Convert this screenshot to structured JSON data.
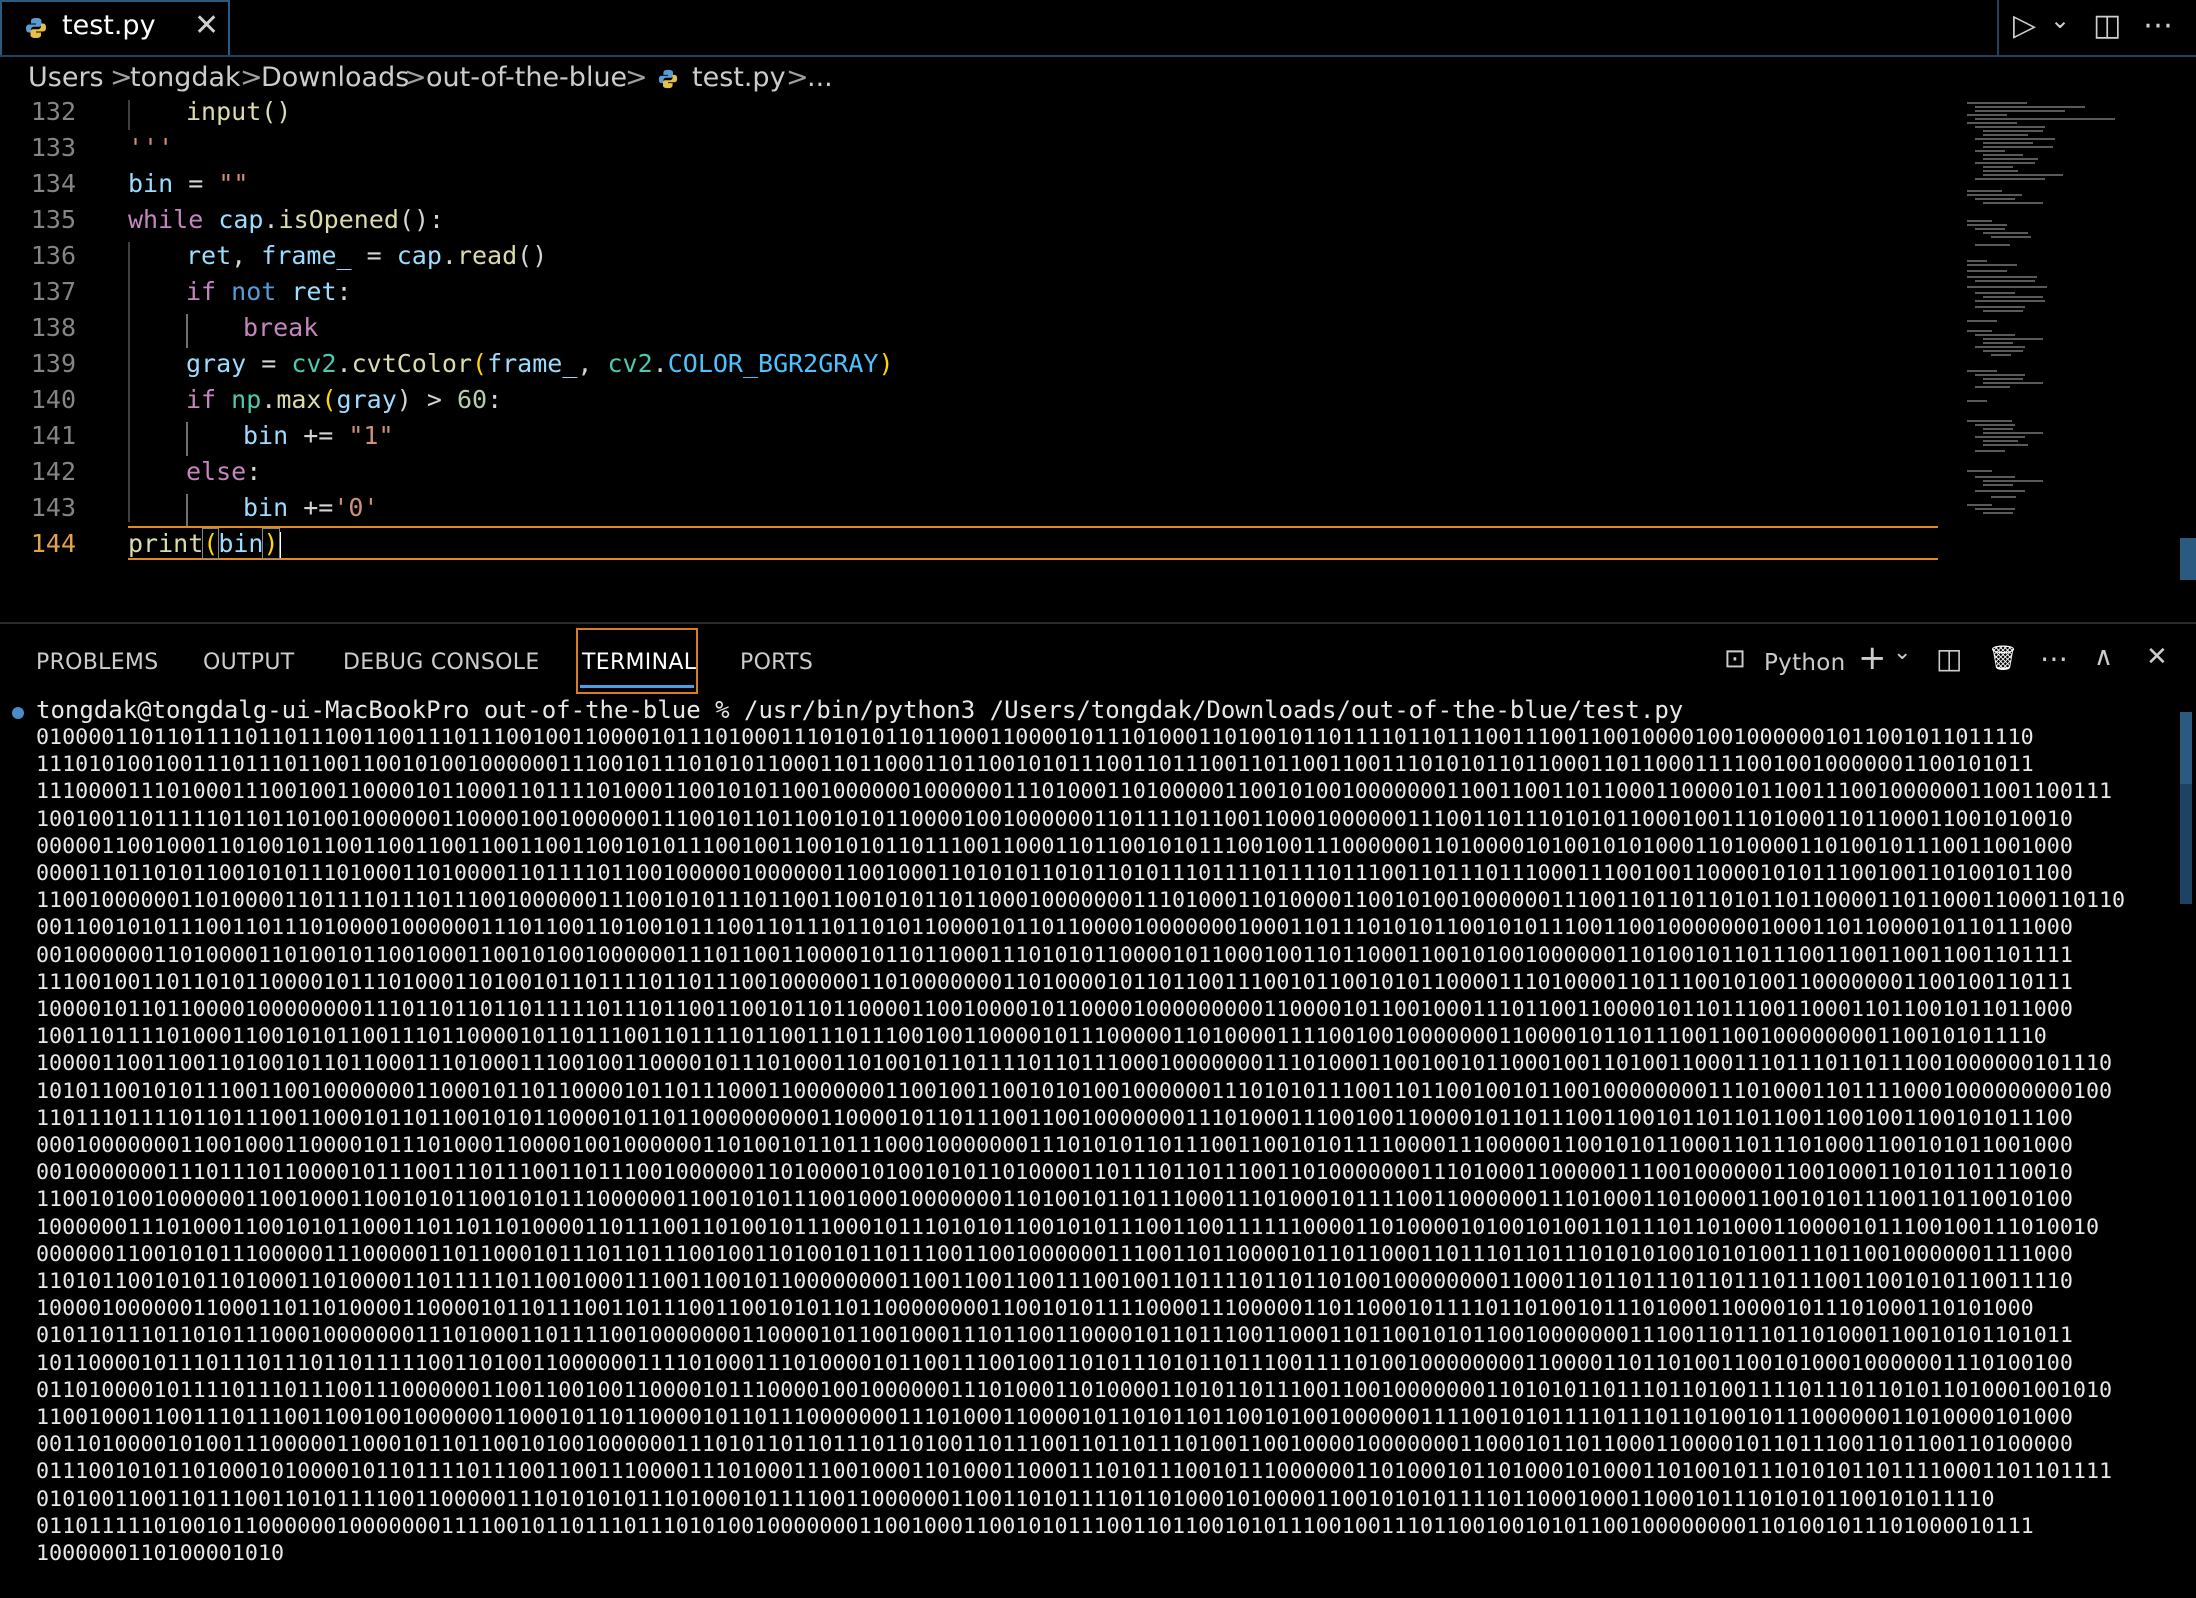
{
  "tab": {
    "filename": "test.py",
    "close": "✕"
  },
  "toolbar": {
    "run": "▷",
    "run_menu": "⌄",
    "split": "◫",
    "more": "⋯"
  },
  "breadcrumbs": [
    "Users",
    "tongdak",
    "Downloads",
    "out-of-the-blue",
    "test.py",
    "..."
  ],
  "breadcrumb_sep": ">",
  "editor": {
    "line_numbers": [
      "132",
      "133",
      "134",
      "135",
      "136",
      "137",
      "138",
      "139",
      "140",
      "141",
      "142",
      "143",
      "144"
    ],
    "current_line": "144"
  },
  "code": {
    "l132": "input()",
    "l133": "'''",
    "l134": {
      "a": "bin",
      "b": " = ",
      "c": "\"\""
    },
    "l135": {
      "a": "while ",
      "b": "cap",
      "c": ".",
      "d": "isOpened",
      "e": "():"
    },
    "l136": {
      "a": "ret",
      "b": ", ",
      "c": "frame_",
      "d": " = ",
      "e": "cap",
      "f": ".",
      "g": "read",
      "h": "()"
    },
    "l137": {
      "a": "if ",
      "b": "not ",
      "c": "ret",
      "d": ":"
    },
    "l138": "break",
    "l139": {
      "a": "gray",
      "b": " = ",
      "c": "cv2",
      "d": ".",
      "e": "cvtColor",
      "f": "(",
      "g": "frame_",
      "h": ", ",
      "i": "cv2",
      "j": ".",
      "k": "COLOR_BGR2GRAY",
      "l": ")"
    },
    "l140": {
      "a": "if ",
      "b": "np",
      "c": ".",
      "d": "max",
      "e": "(",
      "f": "gray",
      "g": ") > ",
      "h": "60",
      "i": ":"
    },
    "l141": {
      "a": "bin",
      "b": " += ",
      "c": "\"1\""
    },
    "l142": {
      "a": "else",
      "b": ":"
    },
    "l143": {
      "a": "bin",
      "b": " +=",
      "c": "'0'"
    },
    "l144": {
      "a": "print",
      "b": "(",
      "c": "bin",
      "d": ")"
    }
  },
  "panel": {
    "tabs": [
      "PROBLEMS",
      "OUTPUT",
      "DEBUG CONSOLE",
      "TERMINAL",
      "PORTS"
    ],
    "active_tab": "TERMINAL",
    "shell_label": "Python",
    "icons": {
      "terminal": "⊡",
      "add": "+",
      "chevron": "⌄",
      "split": "◫",
      "trash": "🗑",
      "more": "⋯",
      "maximize": "∧",
      "close": "✕"
    }
  },
  "terminal": {
    "prompt": "tongdak@tongdalg-ui-MacBookPro out-of-the-blue % /usr/bin/python3 /Users/tongdak/Downloads/out-of-the-blue/test.py",
    "output_lines": [
      "010000110110111101101110011001110111001001100001011101000111010101101100011000010111010001101001011011110110111001110011001000010010000001011001011011110",
      "111010100100111011101100110010100100000011100101110101011000110110001101100101011100110111001101100110011101010110110001101100011110010010000001100101011",
      "111000011101000111001001100001011000110111101000110010101100100000010000001110100011010000011001010010000000110011001101100011000010110011100100000011001100111",
      "100100110111110110110100100000011000010010000001110010110110010101100001001000000110111101100110001000000111001101110101011000100111010001101100011001010010",
      "000001100100011010010110011001100110011001100101011100100110010101101110011000110110010101110010011100000011010000101001010100011010000110100101110011001000",
      "000011011010110010101110100011010000110111101100100000100000011001000110101011010110101110111101111011100110111011100011100100110000101011100100110100101100",
      "1100100000011010000110111101110111001000000111001010111011001100101011011000100000001110100011010000110010100100000011100110110110101101100001101100011000110110",
      "001100101011100110111010000100000011101100110100101110011011101101011000010110110000100000001000110111010101100101011100110010000000100011011000010110111000",
      "001000000110100001101001011001000110010100100000011101100110000101101100011101010110000101100010011011000110010100100000011010010110111001100110011001101111",
      "111001001101101011000010111010001101001011011110110111001000000110100000001101000010110110011100101100101011000011101000011011100101001100000001100100110111",
      "100001011011000010000000011101101101101111101110110011001011011000011001000010110000100000000011000010110010001110110011000010110111001100011011001011011000",
      "1001101111010001100101011001110110000101101110011011110110011101110010011000010111000001101000011110010010000000110000101101110011001000000001100101011110",
      "100001100110011010010110110001110100011100100110000101110100011010010110111101101110001000000011101000110010010110001001101001100011101110110111001000000101110",
      "101011001010111001100100000001100010110110000101101110001100000001100100110010101001000000111010101110011011001001011001000000001110100011011110001000000000100",
      "110111011110110111001100010110110010101100001011011000000000110000101101110011001000000011101000111001001100001011011100110010110110110011001001100101011100",
      "000100000001100100011000010111010001100001001000000110100101101110001000000011101010110111001100101011110000111000001100101011000110111010001100101011001000",
      "001000000011101110110000101110011101110011011100100000011010000101001010110100001101110110111001101000000011101000110000011100100000011001000110101101110010",
      "110010100100000011001000110010101100101011100000011001010111001000100000001101001011011100011101000101111001100000011101000110100001100101011100110110010100",
      "10000001110100011001010110001101101101000011011100110100101110001011101010110010101110011001111110000110100001010010100110111011010001100001011100100111010010",
      "000000110010101110000011100000110110001011101101110010011010010110111001100100000011100110110000101101100011011101101110101010010101001110110010000001111000",
      "110101100101011010001101000011011111011001000111001100101100000000110011001100111001001101111011011010010000000011000110110111011011101110011001010110011110",
      "100001000000110001101101000011000010110111001101110011001010110110000000011001010111100001110000011011000101111011010010111010001100001011101000110101000",
      "010110111011010111000100000001110100011011110010000000110000101100100011101100110000101101110011000110110010101100100000001110011011101101000110010101101011",
      "101100001011101110111011011111001101001100000011110100011101000010110011100100110101110101101110011110100100000000110000110110100110010100010000001110100100",
      "011010000101111011101110011100000011001100100110000101110000100100000011101000110100001101011011100110010000000110101011011101101001111011101101011010001001010",
      "110010001100111011100110010010000001100010110110000101101110000000111010001100001011010110110010100100000011110010101111011101101001011100000011010000101000",
      "001101000010100111000001100010110110010100100000011101011011011101101001101110011011011101001100100001000000011000101101100011000010110111001101100110100000",
      "011100101011010001010000101101111011100110011100001110100011100100011010001100011101011100101110000001101000101101000101000110100101110101011011110001101101111",
      "010100110011011100110101111001100000111010101011101000101111001100000011001101011110110100010100001100101010111101100010001100010111010101100101011110",
      "011011111010010110000001000000011110010110111011101010010000000110010001100101011100110110010101110010011101100100101011001000000001101001011101000010111",
      "1000000110100001010"
    ],
    "cursor": "▯"
  }
}
